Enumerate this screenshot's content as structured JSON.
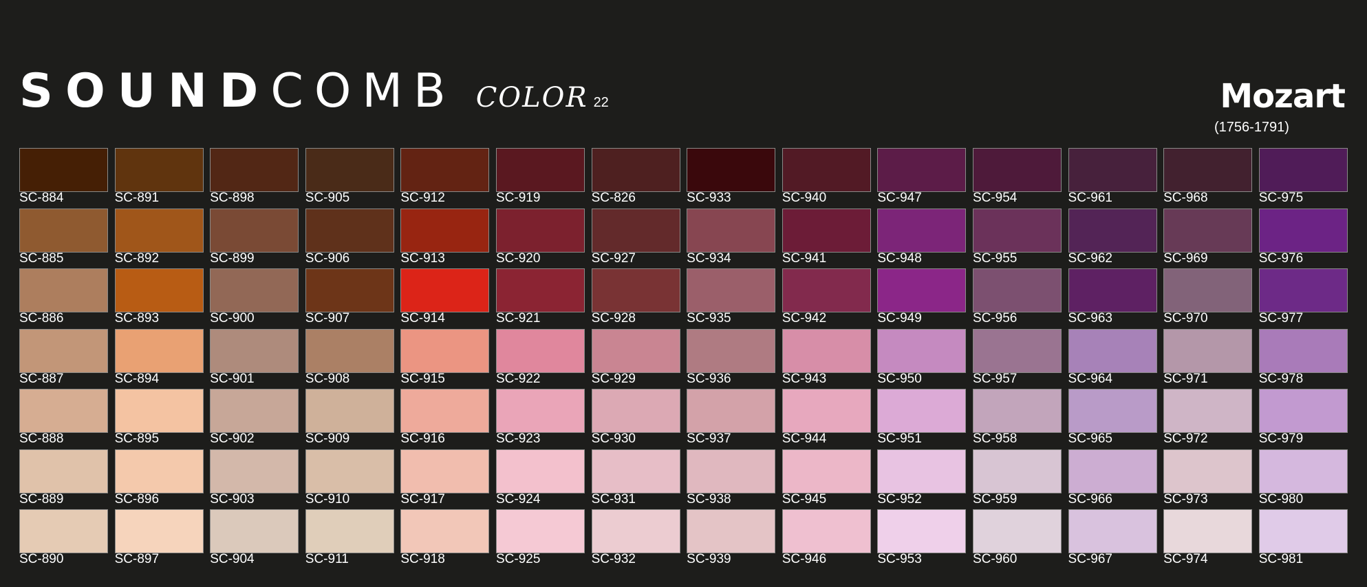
{
  "brand": {
    "logo": "SOUNDCOMB",
    "logo_bold": "SOUND",
    "logo_light": "COMB",
    "sub": "COLOR",
    "number": "22"
  },
  "composer": {
    "name": "Mozart",
    "years": "(1756-1791)"
  },
  "swatches": [
    [
      [
        "SC-884",
        "#451f05"
      ],
      [
        "SC-891",
        "#60340e"
      ],
      [
        "SC-898",
        "#522715"
      ],
      [
        "SC-905",
        "#4a2b18"
      ],
      [
        "SC-912",
        "#632313"
      ],
      [
        "SC-919",
        "#5a1820"
      ],
      [
        "SC-826",
        "#4e2020"
      ],
      [
        "SC-933",
        "#3a080c"
      ],
      [
        "SC-940",
        "#521a25"
      ],
      [
        "SC-947",
        "#5c1c48"
      ],
      [
        "SC-954",
        "#4e1a3a"
      ],
      [
        "SC-961",
        "#47213c"
      ],
      [
        "SC-968",
        "#42212f"
      ],
      [
        "SC-975",
        "#501c58"
      ]
    ],
    [
      [
        "SC-885",
        "#8f5a30"
      ],
      [
        "SC-892",
        "#a0561a"
      ],
      [
        "SC-899",
        "#7a4a35"
      ],
      [
        "SC-906",
        "#5f311b"
      ],
      [
        "SC-913",
        "#982511"
      ],
      [
        "SC-920",
        "#7c212e"
      ],
      [
        "SC-927",
        "#632a2b"
      ],
      [
        "SC-934",
        "#874651"
      ],
      [
        "SC-941",
        "#6c1c37"
      ],
      [
        "SC-948",
        "#7c2578"
      ],
      [
        "SC-955",
        "#6b325a"
      ],
      [
        "SC-962",
        "#532456"
      ],
      [
        "SC-969",
        "#673a56"
      ],
      [
        "SC-976",
        "#6c2385"
      ]
    ],
    [
      [
        "SC-886",
        "#ad7e5e"
      ],
      [
        "SC-893",
        "#b85c14"
      ],
      [
        "SC-900",
        "#926856"
      ],
      [
        "SC-907",
        "#6d3518"
      ],
      [
        "SC-914",
        "#dc2418"
      ],
      [
        "SC-921",
        "#8b2433"
      ],
      [
        "SC-928",
        "#793334"
      ],
      [
        "SC-935",
        "#9b5f6a"
      ],
      [
        "SC-942",
        "#822a4d"
      ],
      [
        "SC-949",
        "#8b2688"
      ],
      [
        "SC-956",
        "#7c5070"
      ],
      [
        "SC-963",
        "#5e2163"
      ],
      [
        "SC-970",
        "#826379"
      ],
      [
        "SC-977",
        "#6d2a87"
      ]
    ],
    [
      [
        "SC-887",
        "#c29678"
      ],
      [
        "SC-894",
        "#e9a173"
      ],
      [
        "SC-901",
        "#ae8b7c"
      ],
      [
        "SC-908",
        "#ab8065"
      ],
      [
        "SC-915",
        "#eb9582"
      ],
      [
        "SC-922",
        "#e0879d"
      ],
      [
        "SC-929",
        "#c98592"
      ],
      [
        "SC-936",
        "#af7b82"
      ],
      [
        "SC-943",
        "#d78ea8"
      ],
      [
        "SC-950",
        "#c58ac0"
      ],
      [
        "SC-957",
        "#9a7491"
      ],
      [
        "SC-964",
        "#a782b8"
      ],
      [
        "SC-971",
        "#b497a9"
      ],
      [
        "SC-978",
        "#a97bb9"
      ]
    ],
    [
      [
        "SC-888",
        "#d6ad92"
      ],
      [
        "SC-895",
        "#f4c3a2"
      ],
      [
        "SC-902",
        "#c7a798"
      ],
      [
        "SC-909",
        "#cfb19a"
      ],
      [
        "SC-916",
        "#eeaa9b"
      ],
      [
        "SC-923",
        "#eaa5b8"
      ],
      [
        "SC-930",
        "#dca9b4"
      ],
      [
        "SC-937",
        "#d3a2a9"
      ],
      [
        "SC-944",
        "#e7a8be"
      ],
      [
        "SC-951",
        "#dcaad6"
      ],
      [
        "SC-958",
        "#c2a5bb"
      ],
      [
        "SC-965",
        "#b99bc8"
      ],
      [
        "SC-972",
        "#cfb5c6"
      ],
      [
        "SC-979",
        "#c29ad0"
      ]
    ],
    [
      [
        "SC-889",
        "#e0c2aa"
      ],
      [
        "SC-896",
        "#f4c9ac"
      ],
      [
        "SC-903",
        "#d3b8aa"
      ],
      [
        "SC-910",
        "#d9bea8"
      ],
      [
        "SC-917",
        "#f1bdae"
      ],
      [
        "SC-924",
        "#f3c1cd"
      ],
      [
        "SC-931",
        "#e7bec7"
      ],
      [
        "SC-938",
        "#e0b8bf"
      ],
      [
        "SC-945",
        "#ecb7c8"
      ],
      [
        "SC-952",
        "#e8c3e2"
      ],
      [
        "SC-959",
        "#d8c5d3"
      ],
      [
        "SC-966",
        "#ccadd2"
      ],
      [
        "SC-973",
        "#ddc5cc"
      ],
      [
        "SC-980",
        "#d5b8de"
      ]
    ],
    [
      [
        "SC-890",
        "#e5cbb4"
      ],
      [
        "SC-897",
        "#f6d4bc"
      ],
      [
        "SC-904",
        "#dbc9bb"
      ],
      [
        "SC-911",
        "#e0ceba"
      ],
      [
        "SC-918",
        "#f2c7b8"
      ],
      [
        "SC-925",
        "#f5c9d4"
      ],
      [
        "SC-932",
        "#ecccd1"
      ],
      [
        "SC-939",
        "#e4c4c6"
      ],
      [
        "SC-946",
        "#efc0d0"
      ],
      [
        "SC-953",
        "#efd0ea"
      ],
      [
        "SC-960",
        "#e0d2dc"
      ],
      [
        "SC-967",
        "#d9c2de"
      ],
      [
        "SC-974",
        "#e8d8db"
      ],
      [
        "SC-981",
        "#e0cbe8"
      ]
    ]
  ]
}
